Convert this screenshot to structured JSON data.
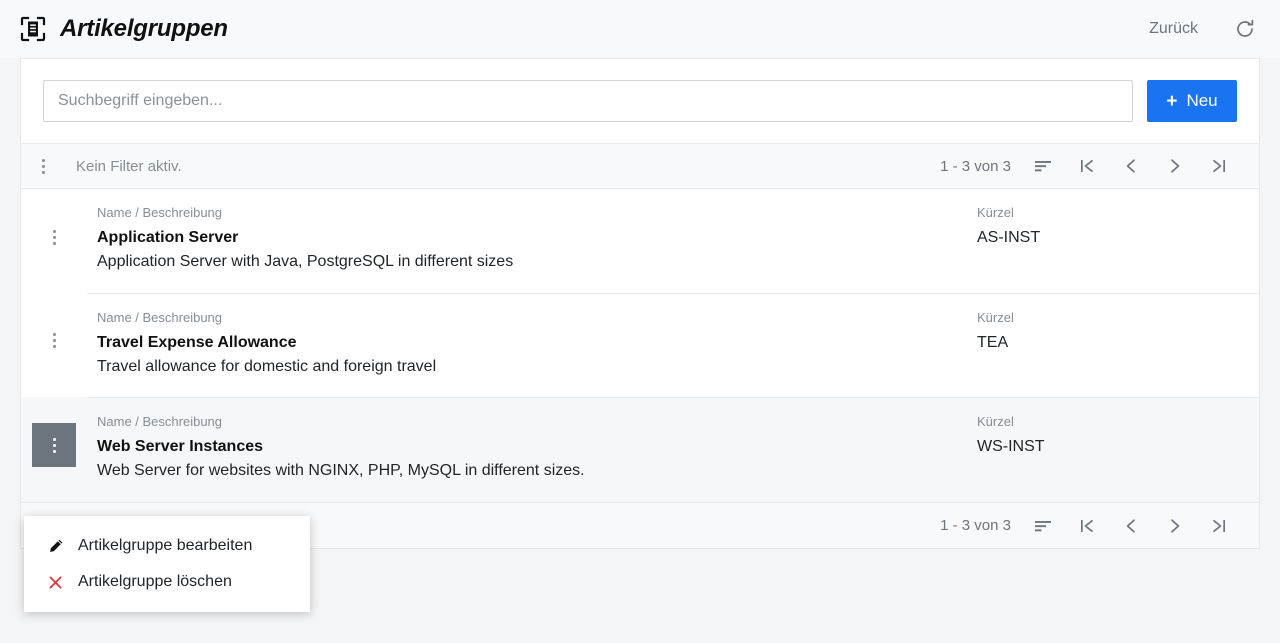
{
  "header": {
    "icon": "scan-document-icon",
    "title": "Artikelgruppen",
    "back_label": "Zurück",
    "refresh_icon": "refresh-icon"
  },
  "search": {
    "placeholder": "Suchbegriff eingeben...",
    "value": "",
    "new_button_label": "Neu",
    "new_button_plus": "+",
    "accent_color": "#1a73f0"
  },
  "filter_bar": {
    "menu_icon": "kebab-menu-icon",
    "status_text": "Kein Filter aktiv."
  },
  "pager": {
    "count_text": "1 - 3 von 3",
    "sort_icon": "sort-icon",
    "first_icon": "first-page-icon",
    "prev_icon": "previous-page-icon",
    "next_icon": "next-page-icon",
    "last_icon": "last-page-icon"
  },
  "columns": {
    "name_label": "Name / Beschreibung",
    "kurzel_label": "Kürzel"
  },
  "rows": [
    {
      "name": "Application Server",
      "description": "Application Server with Java, PostgreSQL in different sizes",
      "kurzel": "AS-INST",
      "highlighted": false
    },
    {
      "name": "Travel Expense Allowance",
      "description": "Travel allowance for domestic and foreign travel",
      "kurzel": "TEA",
      "highlighted": false
    },
    {
      "name": "Web Server Instances",
      "description": "Web Server for websites with NGINX, PHP, MySQL in different sizes.",
      "kurzel": "WS-INST",
      "highlighted": true
    }
  ],
  "context_menu": {
    "items": [
      {
        "label": "Artikelgruppe bearbeiten",
        "icon": "pencil-icon"
      },
      {
        "label": "Artikelgruppe löschen",
        "icon": "close-x-icon"
      }
    ]
  }
}
